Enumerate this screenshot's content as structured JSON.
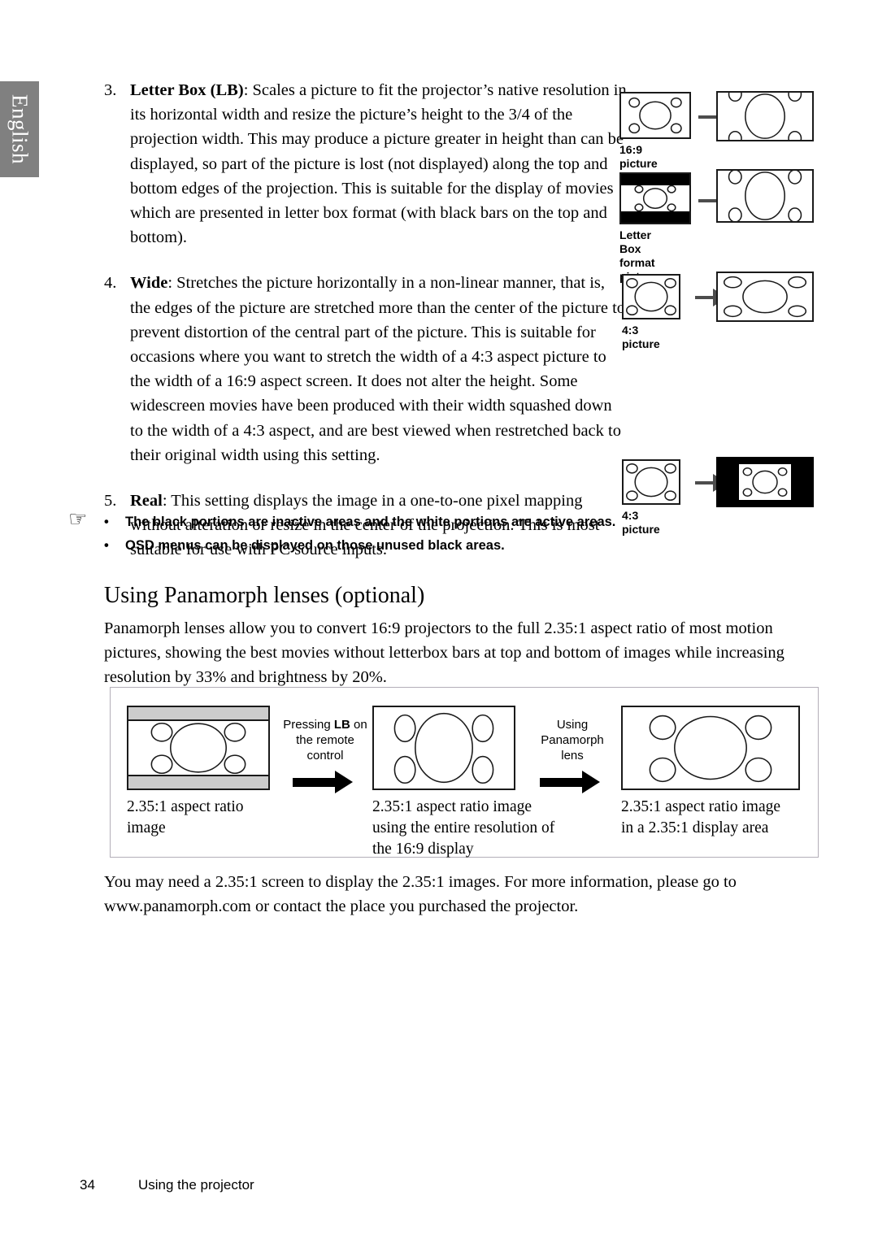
{
  "side_tab": {
    "label": "English"
  },
  "list": [
    {
      "number": "3.",
      "term": "Letter Box (LB)",
      "text": ": Scales a picture to fit the projector’s native resolution in its horizontal width and resize the picture’s height to the 3/4 of the projection width. This may produce a picture greater in height than can be displayed, so part of the picture is lost (not displayed) along the top and bottom edges of the projection. This is suitable for the display of movies which are presented in letter box format (with black bars on the top and bottom)."
    },
    {
      "number": "4.",
      "term": "Wide",
      "text": ": Stretches the picture horizontally in a non-linear manner, that is, the edges of the picture are stretched more than the center of the picture to prevent distortion of the central part of the picture. This is suitable for occasions where you want to stretch the width of a 4:3 aspect picture to the width of a 16:9 aspect screen. It does not alter the height. Some widescreen movies have been produced with their width squashed down to the width of a 4:3 aspect, and are best viewed when restretched back to their original width using this setting."
    },
    {
      "number": "5.",
      "term": "Real",
      "text": ": This setting displays the image in a one-to-one pixel mapping without alteration or resize in the center of the projection. This is most suitable for use with PC source inputs."
    }
  ],
  "diagrams": [
    {
      "caption": "16:9 picture"
    },
    {
      "caption": "Letter Box\nformat picture",
      "caption_line1": "Letter Box",
      "caption_line2": "format picture"
    },
    {
      "caption": "4:3 picture"
    },
    {
      "caption": "4:3 picture"
    }
  ],
  "notes": {
    "hand_icon": "☞",
    "bullet": "•",
    "items": [
      "The black portions are inactive areas and the white portions are active areas.",
      "OSD menus can be displayed on those unused black areas."
    ]
  },
  "section": {
    "heading": "Using Panamorph lenses (optional)",
    "body": "Panamorph lenses allow you to convert 16:9 projectors to the full 2.35:1 aspect ratio of most motion pictures, showing the best movies without letterbox bars at top and bottom of images while increasing resolution by 33% and brightness by 20%."
  },
  "figure": {
    "panels": [
      {
        "caption_line1": "2.35:1 aspect ratio",
        "caption_line2": "image",
        "caption_line3": ""
      },
      {
        "caption_line1": "2.35:1 aspect ratio image",
        "caption_line2": "using the entire resolution of",
        "caption_line3": "the 16:9 display"
      },
      {
        "caption_line1": "2.35:1 aspect ratio image",
        "caption_line2": "in a 2.35:1 display area",
        "caption_line3": ""
      }
    ],
    "labels": [
      {
        "pre": "Pressing ",
        "strong": "LB",
        "post": " on",
        "line2": "the remote",
        "line3": "control"
      },
      {
        "pre": "",
        "strong": "",
        "post": "Using",
        "line2": "Panamorph",
        "line3": "lens"
      }
    ]
  },
  "closing": "You may need a 2.35:1 screen to display the 2.35:1 images. For more information, please go to www.panamorph.com or contact the place you purchased the projector.",
  "footer": {
    "page": "34",
    "title": "Using the projector"
  },
  "colors": {
    "tab_bg": "#808080",
    "stroke": "#1a1a1a",
    "arrow": "#4d4d4d",
    "black": "#000000",
    "letterbox_gray": "#cccccc",
    "figure_border": "#b3aeb8"
  }
}
